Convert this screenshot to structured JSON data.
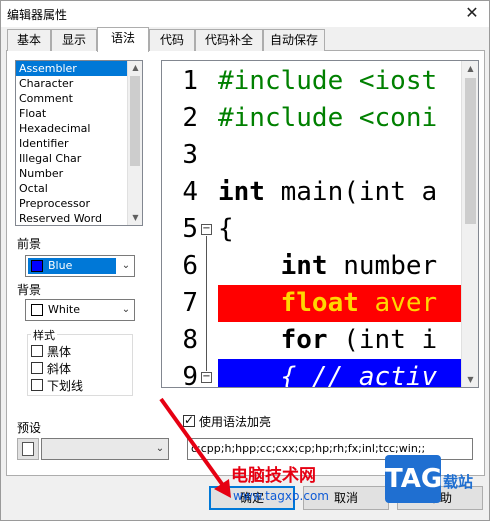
{
  "window": {
    "title": "编辑器属性",
    "close_glyph": "✕"
  },
  "tabs": [
    {
      "label": "基本",
      "active": false
    },
    {
      "label": "显示",
      "active": false
    },
    {
      "label": "语法",
      "active": true
    },
    {
      "label": "代码",
      "active": false
    },
    {
      "label": "代码补全",
      "active": false
    },
    {
      "label": "自动保存",
      "active": false
    }
  ],
  "style_list": {
    "items": [
      "Assembler",
      "Character",
      "Comment",
      "Float",
      "Hexadecimal",
      "Identifier",
      "Illegal Char",
      "Number",
      "Octal",
      "Preprocessor",
      "Reserved Word"
    ],
    "selected": "Assembler"
  },
  "foreground": {
    "label": "前景",
    "value": "Blue",
    "color": "#0000ff"
  },
  "background": {
    "label": "背景",
    "value": "White",
    "color": "#ffffff"
  },
  "font_style": {
    "label": "样式",
    "bold": {
      "label": "黑体",
      "checked": false
    },
    "italic": {
      "label": "斜体",
      "checked": false
    },
    "underline": {
      "label": "下划线",
      "checked": false
    }
  },
  "preview": {
    "line_numbers": [
      "1",
      "2",
      "3",
      "4",
      "5",
      "6",
      "7",
      "8",
      "9"
    ],
    "lines": [
      {
        "prefix": "",
        "keyword": "",
        "text": "#include <iost",
        "kind": "preprocessor"
      },
      {
        "prefix": "",
        "keyword": "",
        "text": "#include <coni",
        "kind": "preprocessor"
      },
      {
        "prefix": "",
        "keyword": "",
        "text": "",
        "kind": "plain"
      },
      {
        "prefix": "",
        "keyword": "int",
        "text": " main(int a",
        "kind": "plain"
      },
      {
        "prefix": "",
        "keyword": "",
        "text": "{",
        "kind": "plain"
      },
      {
        "prefix": "    ",
        "keyword": "int",
        "text": " number",
        "kind": "plain"
      },
      {
        "prefix": "    ",
        "keyword": "float",
        "text": " aver",
        "kind": "error"
      },
      {
        "prefix": "    ",
        "keyword": "for",
        "text": " (int i",
        "kind": "plain"
      },
      {
        "prefix": "    ",
        "keyword": "",
        "text": "{ // activ",
        "kind": "active"
      }
    ],
    "colors": {
      "preprocessor": "#008000",
      "error_bg": "#ff0000",
      "error_fg": "#ffd700",
      "active_bg": "#0000ff",
      "active_fg": "#ffffff"
    }
  },
  "use_syntax_highlight": {
    "label": "使用语法加亮",
    "checked": true
  },
  "preset": {
    "label": "预设",
    "value": ""
  },
  "extensions": {
    "value": "c;cpp;h;hpp;cc;cxx;cp;hp;rh;fx;inl;tcc;win;;"
  },
  "buttons": {
    "ok": "确定",
    "cancel": "取消",
    "help": "帮助"
  },
  "watermark": {
    "brand": "电脑技术网",
    "url": "www.tagxp.com",
    "tag": "TAG",
    "side": "载站"
  }
}
